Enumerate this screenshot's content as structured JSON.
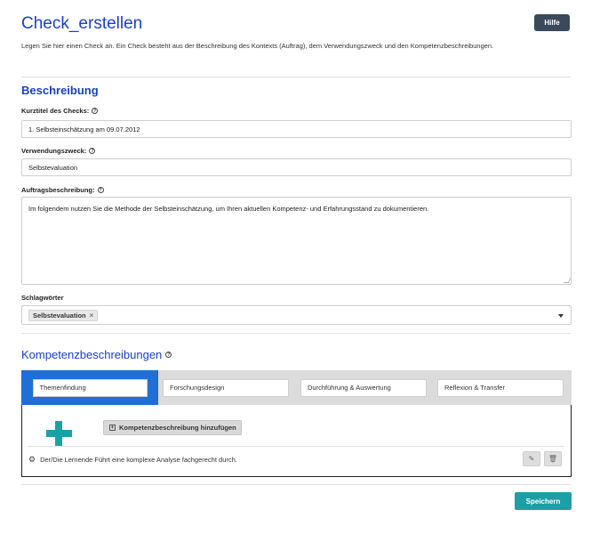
{
  "header": {
    "title": "Check_erstellen",
    "help_label": "Hilfe",
    "intro": "Legen Sie hier einen Check an. Ein Check besteht aus der Beschreibung des Kontexts (Auftrag), dem Verwendungszweck und den Kompetenzbeschreibungen."
  },
  "beschreibung": {
    "section_title": "Beschreibung",
    "kurztitel_label": "Kurztitel des Checks:",
    "kurztitel_value": "1. Selbsteinschätzung am 09.07.2012",
    "verwendung_label": "Verwendungszweck:",
    "verwendung_value": "Selbstevaluation",
    "auftrag_label": "Auftragsbeschreibung:",
    "auftrag_value": "Im folgendem nutzen Sie die Methode der Selbsteinschätzung, um Ihren aktuellen Kompetenz- und Erfahrungsstand zu dokumentieren.",
    "schlag_label": "Schlagwörter",
    "tags": [
      "Selbstevaluation"
    ]
  },
  "kompetenz": {
    "section_title": "Kompetenzbeschreibungen",
    "tabs": [
      "Themenfindung",
      "Forschungsdesign",
      "Durchführung & Auswertung",
      "Reflexion & Transfer"
    ],
    "add_label": "Kompetenzbeschreibung hinzufügen",
    "item_text": "Der/Die Lernende Führt eine komplexe Analyse fachgerecht durch."
  },
  "icons": {
    "help": "question-circle-icon",
    "remove": "close-icon",
    "dropdown": "chevron-down-icon",
    "add": "plus-square-icon",
    "big_add": "plus-icon",
    "item": "gears-icon",
    "edit": "edit-icon",
    "delete": "trash-icon"
  },
  "colors": {
    "title": "#1a3fd1",
    "active_tab": "#1f6fd6",
    "accent": "#1d9fa6",
    "help_button": "#3a4a5c"
  },
  "footer": {
    "save_label": "Speichern"
  }
}
